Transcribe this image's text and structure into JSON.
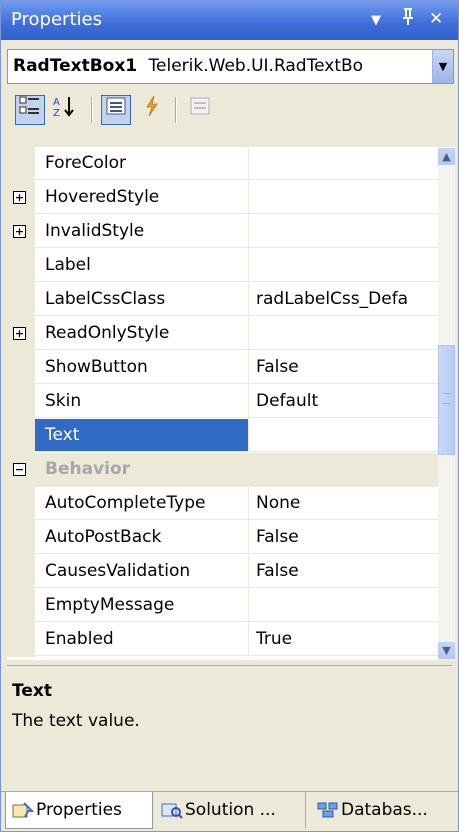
{
  "window": {
    "title": "Properties"
  },
  "title_buttons": {
    "dropdown": "▼",
    "pin": "Ʉ",
    "close": "✕"
  },
  "selector": {
    "object_name": "RadTextBox1",
    "object_type": "Telerik.Web.UI.RadTextBo"
  },
  "grid": {
    "rows": [
      {
        "name": "ForeColor",
        "value": "",
        "expandable": false
      },
      {
        "name": "HoveredStyle",
        "value": "",
        "expandable": true
      },
      {
        "name": "InvalidStyle",
        "value": "",
        "expandable": true
      },
      {
        "name": "Label",
        "value": "",
        "expandable": false
      },
      {
        "name": "LabelCssClass",
        "value": "radLabelCss_Defa",
        "expandable": false
      },
      {
        "name": "ReadOnlyStyle",
        "value": "",
        "expandable": true
      },
      {
        "name": "ShowButton",
        "value": "False",
        "expandable": false
      },
      {
        "name": "Skin",
        "value": "Default",
        "expandable": false
      },
      {
        "name": "Text",
        "value": "",
        "expandable": false,
        "selected": true
      }
    ],
    "category": "Behavior",
    "behavior_rows": [
      {
        "name": "AutoCompleteType",
        "value": "None"
      },
      {
        "name": "AutoPostBack",
        "value": "False"
      },
      {
        "name": "CausesValidation",
        "value": "False"
      },
      {
        "name": "EmptyMessage",
        "value": ""
      },
      {
        "name": "Enabled",
        "value": "True"
      }
    ]
  },
  "description": {
    "title": "Text",
    "text": "The text value."
  },
  "tabs": [
    {
      "label": "Properties",
      "active": true
    },
    {
      "label": "Solution ...",
      "active": false
    },
    {
      "label": "Databas...",
      "active": false
    }
  ],
  "expander": {
    "plus": "+",
    "minus": "−"
  }
}
